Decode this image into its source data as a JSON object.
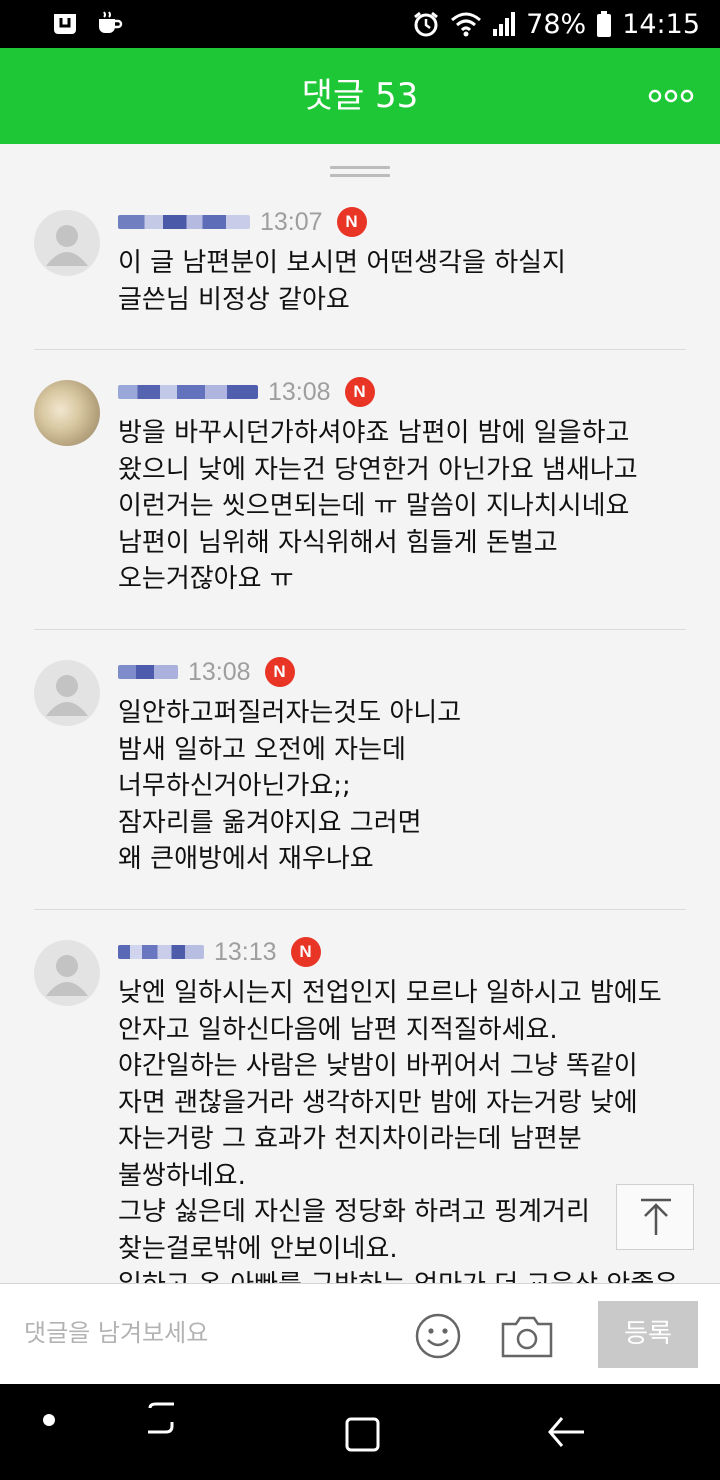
{
  "status_bar": {
    "battery": "78%",
    "time": "14:15",
    "icons": [
      "app-icon",
      "coffee-icon",
      "alarm-icon",
      "wifi-icon",
      "signal-icon",
      "battery-icon"
    ]
  },
  "header": {
    "title": "댓글 53",
    "more_icon": "more-dots-icon",
    "background": "#1ec736"
  },
  "comments": [
    {
      "time": "13:07",
      "badge": "N",
      "lines": [
        "이 글 남편분이 보시면 어떤생각을 하실지",
        "글쓴님 비정상 같아요"
      ]
    },
    {
      "time": "13:08",
      "badge": "N",
      "lines": [
        "방을 바꾸시던가하셔야죠 남편이 밤에 일을하고",
        "왔으니 낮에 자는건 당연한거 아닌가요 냄새나고",
        "이런거는 씻으면되는데 ㅠ 말씀이 지나치시네요",
        "남편이 님위해 자식위해서 힘들게 돈벌고",
        "오는거잖아요 ㅠ"
      ]
    },
    {
      "time": "13:08",
      "badge": "N",
      "lines": [
        "일안하고퍼질러자는것도 아니고",
        "밤새 일하고 오전에 자는데",
        "너무하신거아닌가요;;",
        "잠자리를 옮겨야지요 그러면",
        "왜 큰애방에서 재우나요"
      ]
    },
    {
      "time": "13:13",
      "badge": "N",
      "lines": [
        "낮엔 일하시는지 전업인지 모르나 일하시고 밤에도",
        "안자고 일하신다음에 남편 지적질하세요.",
        "야간일하는 사람은 낮밤이 바뀌어서 그냥 똑같이",
        "자면 괜찮을거라 생각하지만 밤에 자는거랑 낮에",
        "자는거랑 그 효과가 천지차이라는데 남편분",
        "불쌍하네요.",
        "그냥 싫은데 자신을 정당화 하려고 핑계거리",
        "찾는걸로밖에 안보이네요.",
        "일하고 온 아빠를 구박하는 엄마가 더 교육상 안좋은"
      ]
    }
  ],
  "input_bar": {
    "placeholder": "댓글을 남겨보세요",
    "submit_label": "등록"
  },
  "colors": {
    "badge": "#e83526",
    "submit_disabled": "#c9c9c9"
  }
}
